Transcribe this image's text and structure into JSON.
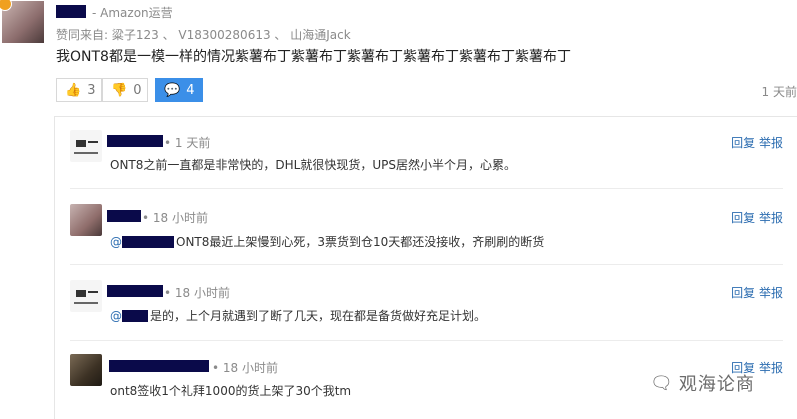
{
  "post": {
    "author_suffix": "- Amazon运营",
    "likers_prefix": "赞同来自:",
    "likers": "粱子123 、 V18300280613 、 山海通Jack",
    "content": "我ONT8都是一模一样的情况紫薯布丁紫薯布丁紫薯布丁紫薯布丁紫薯布丁紫薯布丁",
    "time": "1 天前",
    "upvotes": "3",
    "downvotes": "0",
    "comments": "4"
  },
  "replies": [
    {
      "time": "• 1 天前",
      "text": "ONT8之前一直都是非常快的，DHL就很快现货，UPS居然小半个月，心累。",
      "actions": "回复 举报"
    },
    {
      "time": "• 18 小时前",
      "at": "@",
      "text": "ONT8最近上架慢到心死，3票货到仓10天都还没接收，齐刷刷的断货",
      "actions": "回复 举报"
    },
    {
      "time": "• 18 小时前",
      "at": "@",
      "text": "是的，上个月就遇到了断了几天，现在都是备货做好充足计划。",
      "actions": "回复 举报"
    },
    {
      "time": "• 18 小时前",
      "text": "ont8签收1个礼拜1000的货上架了30个我tm",
      "actions": "回复 举报"
    }
  ],
  "watermark": {
    "text": "观海论商"
  }
}
